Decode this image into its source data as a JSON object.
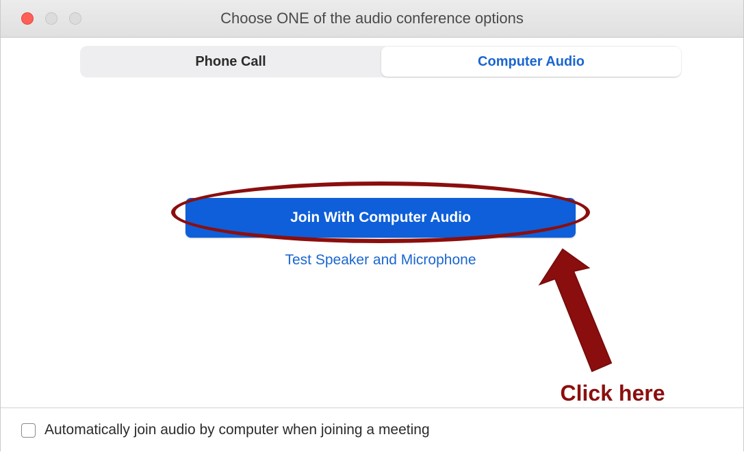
{
  "window": {
    "title": "Choose ONE of the audio conference options"
  },
  "tabs": [
    {
      "label": "Phone Call",
      "selected": false
    },
    {
      "label": "Computer Audio",
      "selected": true
    }
  ],
  "main": {
    "join_button_label": "Join With Computer Audio",
    "test_link_label": "Test Speaker and Microphone"
  },
  "footer": {
    "auto_join_label": "Automatically join audio by computer when joining a meeting",
    "auto_join_checked": false
  },
  "annotation": {
    "text": "Click here",
    "color": "#8b0e0e"
  },
  "colors": {
    "accent": "#0e5fd9",
    "link": "#1a66d0",
    "close_button": "#fe5f57"
  },
  "icons": [
    "close-window-icon",
    "minimize-window-icon",
    "maximize-window-icon",
    "arrow-annotation-icon"
  ]
}
